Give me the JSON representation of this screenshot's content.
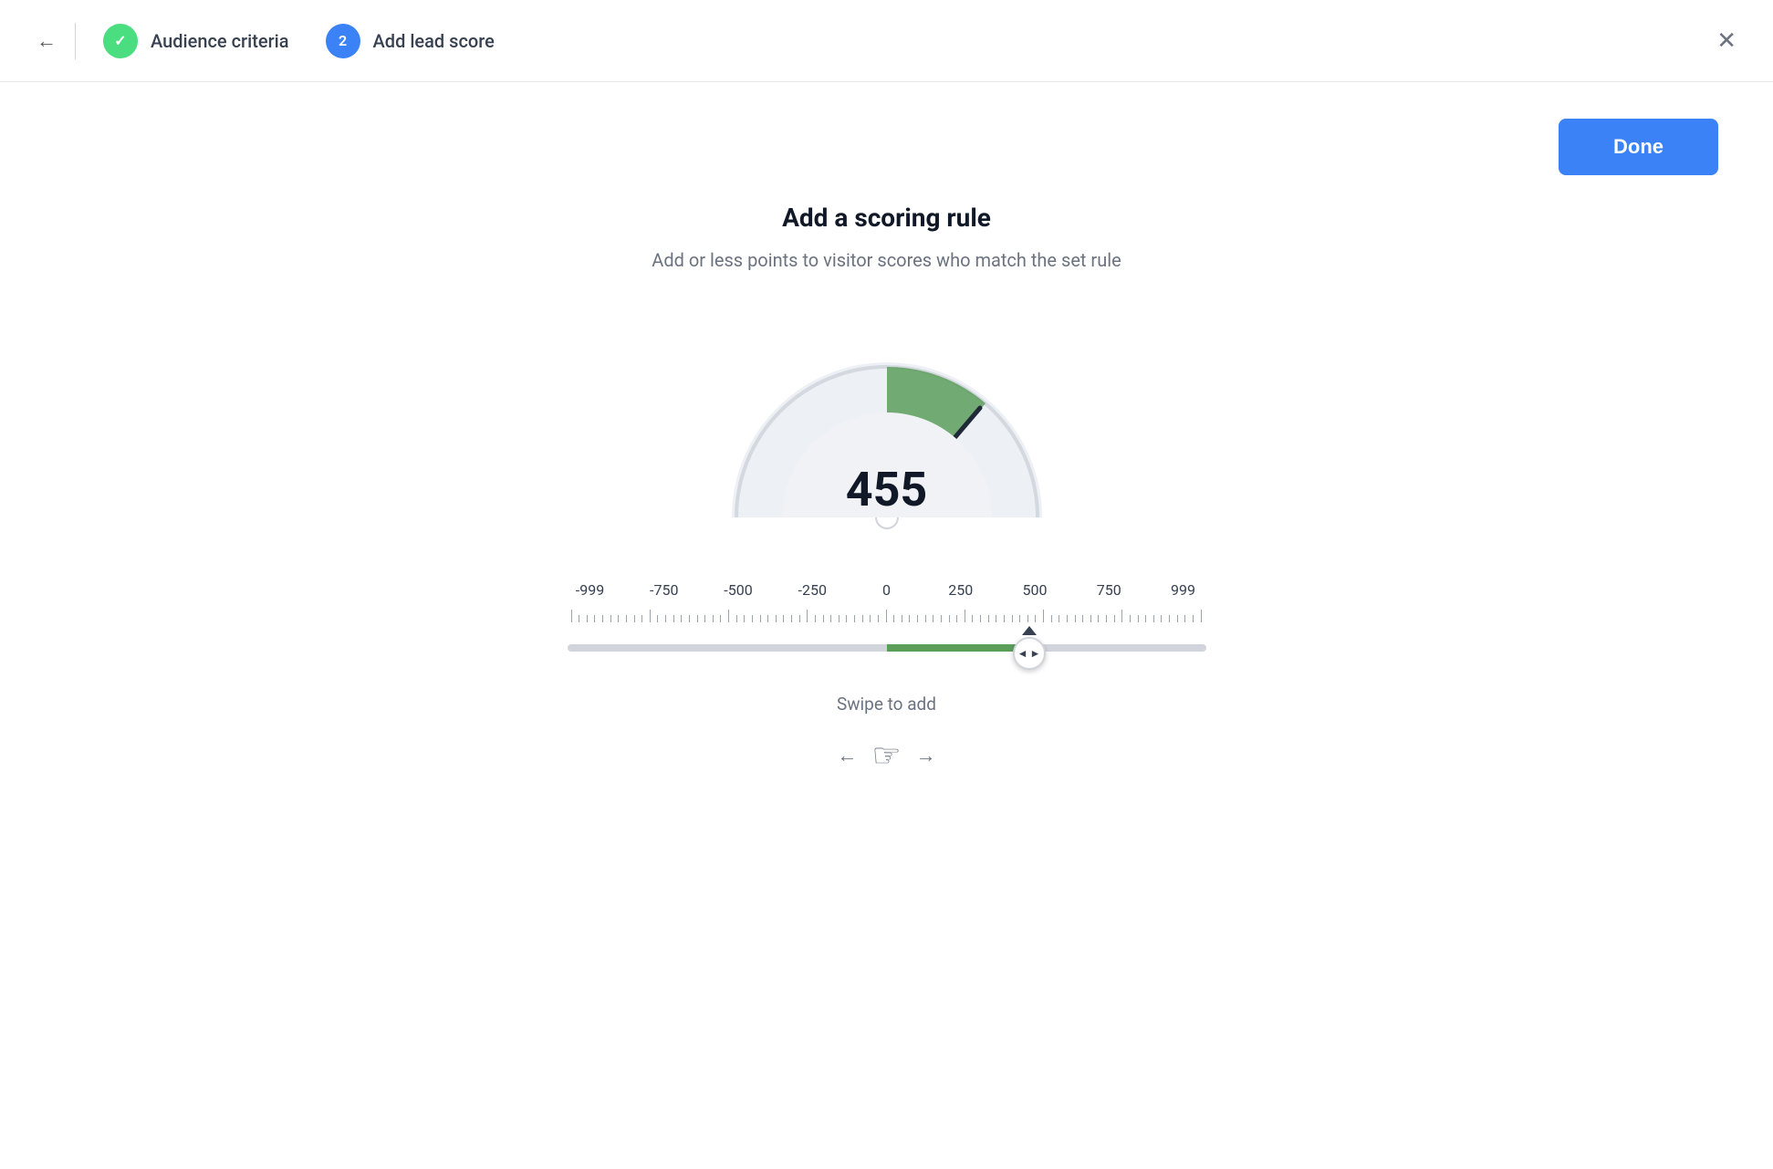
{
  "header": {
    "back_label": "←",
    "step1": {
      "label": "Audience criteria",
      "state": "done",
      "icon": "✓"
    },
    "step2": {
      "label": "Add lead score",
      "state": "active",
      "number": "2"
    },
    "close_label": "✕"
  },
  "toolbar": {
    "done_label": "Done"
  },
  "main": {
    "title": "Add a scoring rule",
    "subtitle": "Add or less points to visitor scores who match the set rule",
    "gauge_value": "455",
    "slider": {
      "labels": [
        "-999",
        "-750",
        "-500",
        "-250",
        "0",
        "250",
        "500",
        "750",
        "999"
      ],
      "current_value": 455
    },
    "swipe_label": "Swipe to add"
  },
  "colors": {
    "green_check": "#4ade80",
    "blue_active": "#3b82f6",
    "gauge_green": "#5a9e5a",
    "gauge_bg": "#e8ecf0",
    "gauge_needle": "#1f2937",
    "slider_fill": "#5a9e5a"
  }
}
